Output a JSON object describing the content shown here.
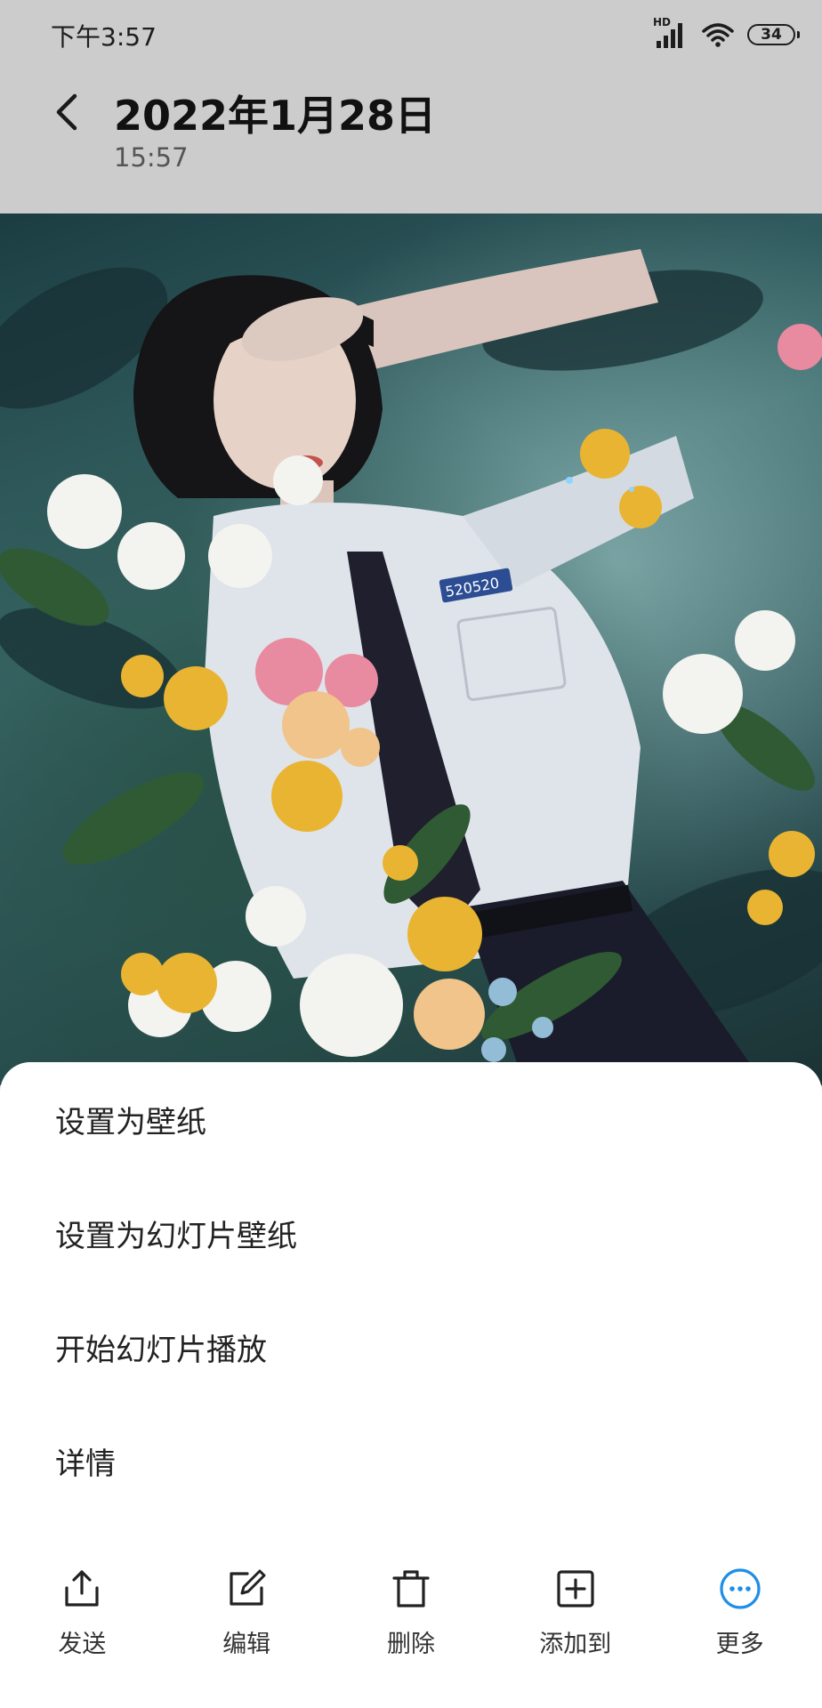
{
  "status_bar": {
    "time": "下午3:57",
    "signal_badge": "HD",
    "battery": "34"
  },
  "header": {
    "title": "2022年1月28日",
    "subtitle": "15:57"
  },
  "photo": {
    "badge_text": "520520"
  },
  "menu": {
    "items": [
      {
        "label": "设置为壁纸"
      },
      {
        "label": "设置为幻灯片壁纸"
      },
      {
        "label": "开始幻灯片播放"
      },
      {
        "label": "详情"
      }
    ]
  },
  "bottom_bar": {
    "items": [
      {
        "label": "发送",
        "icon": "share-icon"
      },
      {
        "label": "编辑",
        "icon": "edit-icon"
      },
      {
        "label": "删除",
        "icon": "trash-icon"
      },
      {
        "label": "添加到",
        "icon": "add-box-icon"
      },
      {
        "label": "更多",
        "icon": "more-icon"
      }
    ]
  },
  "colors": {
    "header_bg": "#cccccc",
    "accent": "#1e8fe8",
    "sheet_bg": "#ffffff"
  }
}
